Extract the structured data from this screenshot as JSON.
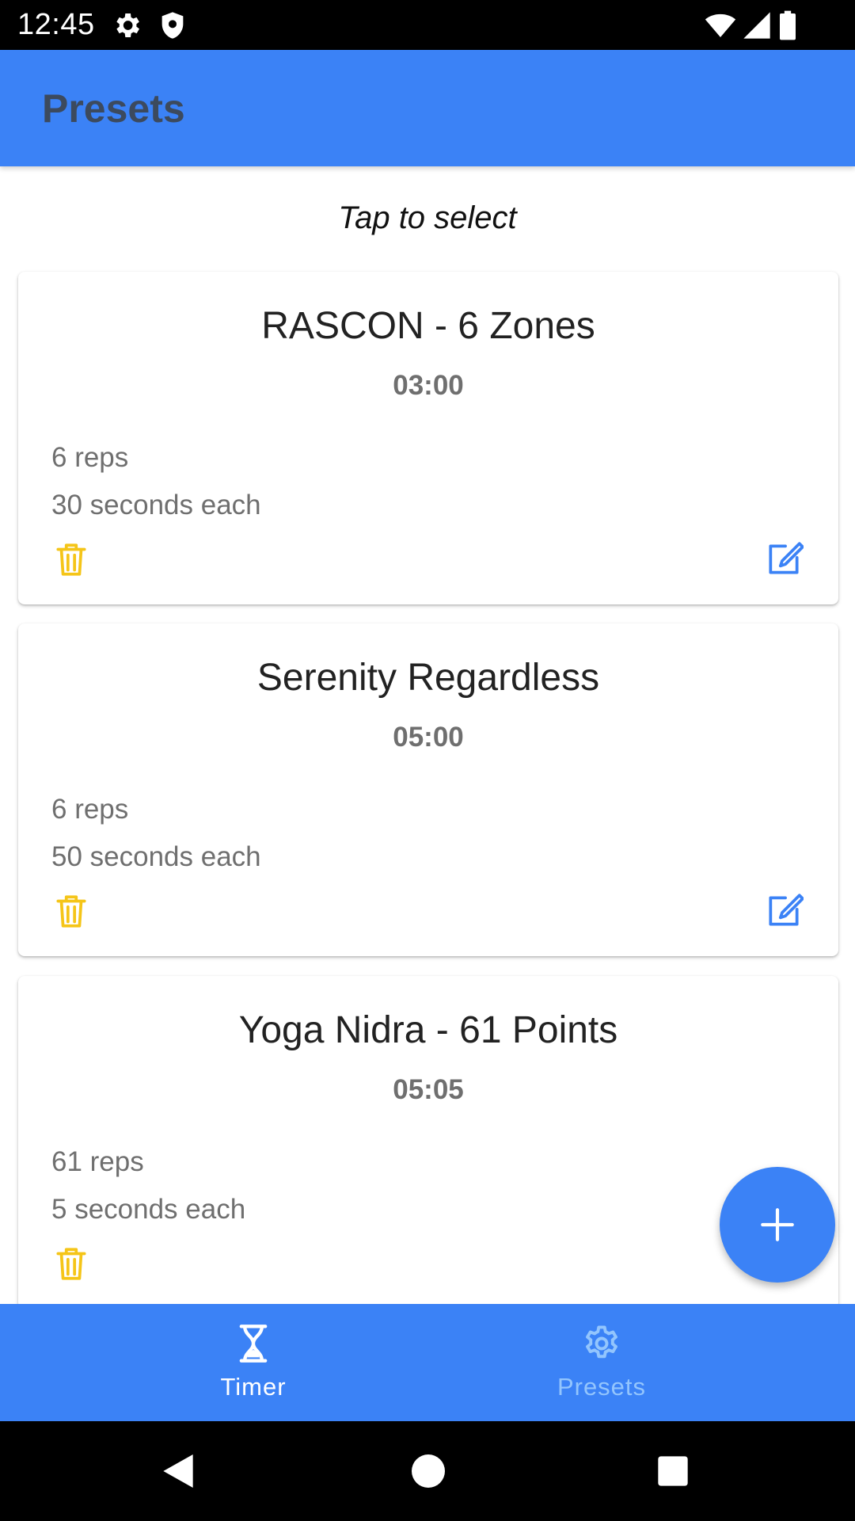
{
  "status_bar": {
    "time": "12:45"
  },
  "app_bar": {
    "title": "Presets"
  },
  "hint": "Tap to select",
  "presets": [
    {
      "title": "RASCON - 6 Zones",
      "duration": "03:00",
      "reps": "6 reps",
      "each": "30 seconds each"
    },
    {
      "title": "Serenity Regardless",
      "duration": "05:00",
      "reps": "6 reps",
      "each": "50 seconds each"
    },
    {
      "title": "Yoga Nidra - 61 Points",
      "duration": "05:05",
      "reps": "61 reps",
      "each": "5 seconds each"
    }
  ],
  "icons": {
    "delete": "trash-icon",
    "edit": "edit-icon",
    "add": "plus-icon",
    "timer": "hourglass-icon",
    "presets": "gear-icon"
  },
  "bottom_nav": {
    "items": [
      {
        "label": "Timer",
        "active": true
      },
      {
        "label": "Presets",
        "active": false
      }
    ]
  },
  "colors": {
    "primary": "#3b82f6",
    "title_text": "#3c4a5e",
    "delete_icon": "#f5c518",
    "edit_icon": "#3b82f6",
    "nav_active": "#ffffff",
    "nav_inactive": "#93c5fd"
  }
}
